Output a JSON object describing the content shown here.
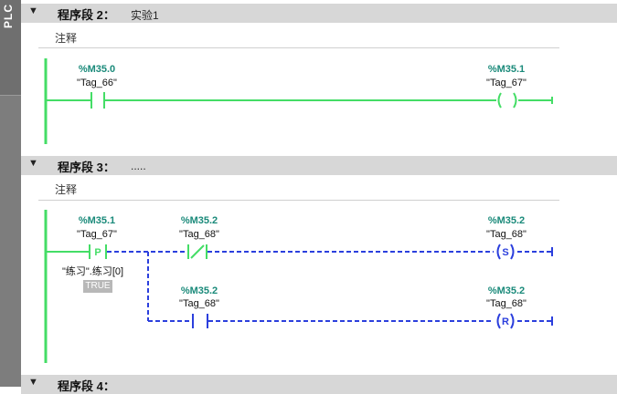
{
  "sidebar": {
    "label": "PLC"
  },
  "networks": [
    {
      "title": "程序段 2：",
      "subtitle": "实验1",
      "comment": "注释"
    },
    {
      "title": "程序段 3：",
      "subtitle": ".....",
      "comment": "注释"
    },
    {
      "title": "程序段 4："
    }
  ],
  "net2": {
    "contact": {
      "address": "%M35.0",
      "tag": "\"Tag_66\""
    },
    "coil": {
      "address": "%M35.1",
      "tag": "\"Tag_67\""
    }
  },
  "net3": {
    "p_contact": {
      "address": "%M35.1",
      "tag": "\"Tag_67\"",
      "symbol": "P",
      "edge_operand": "\"练习\".练习[0]",
      "state": "TRUE"
    },
    "nc_contact": {
      "address": "%M35.2",
      "tag": "\"Tag_68\""
    },
    "set_coil": {
      "address": "%M35.2",
      "tag": "\"Tag_68\"",
      "symbol": "S"
    },
    "no_contact": {
      "address": "%M35.2",
      "tag": "\"Tag_68\""
    },
    "reset_coil": {
      "address": "%M35.2",
      "tag": "\"Tag_68\"",
      "symbol": "R"
    }
  },
  "colors": {
    "powered": "#44dd66",
    "unpowered": "#2b3fdd",
    "address": "#1a8a7a",
    "header": "#d7d7d7",
    "sidebar": "#7d7d7d"
  },
  "icons": [
    "collapse-arrow-icon",
    "collapse-arrow-icon",
    "collapse-arrow-icon"
  ]
}
